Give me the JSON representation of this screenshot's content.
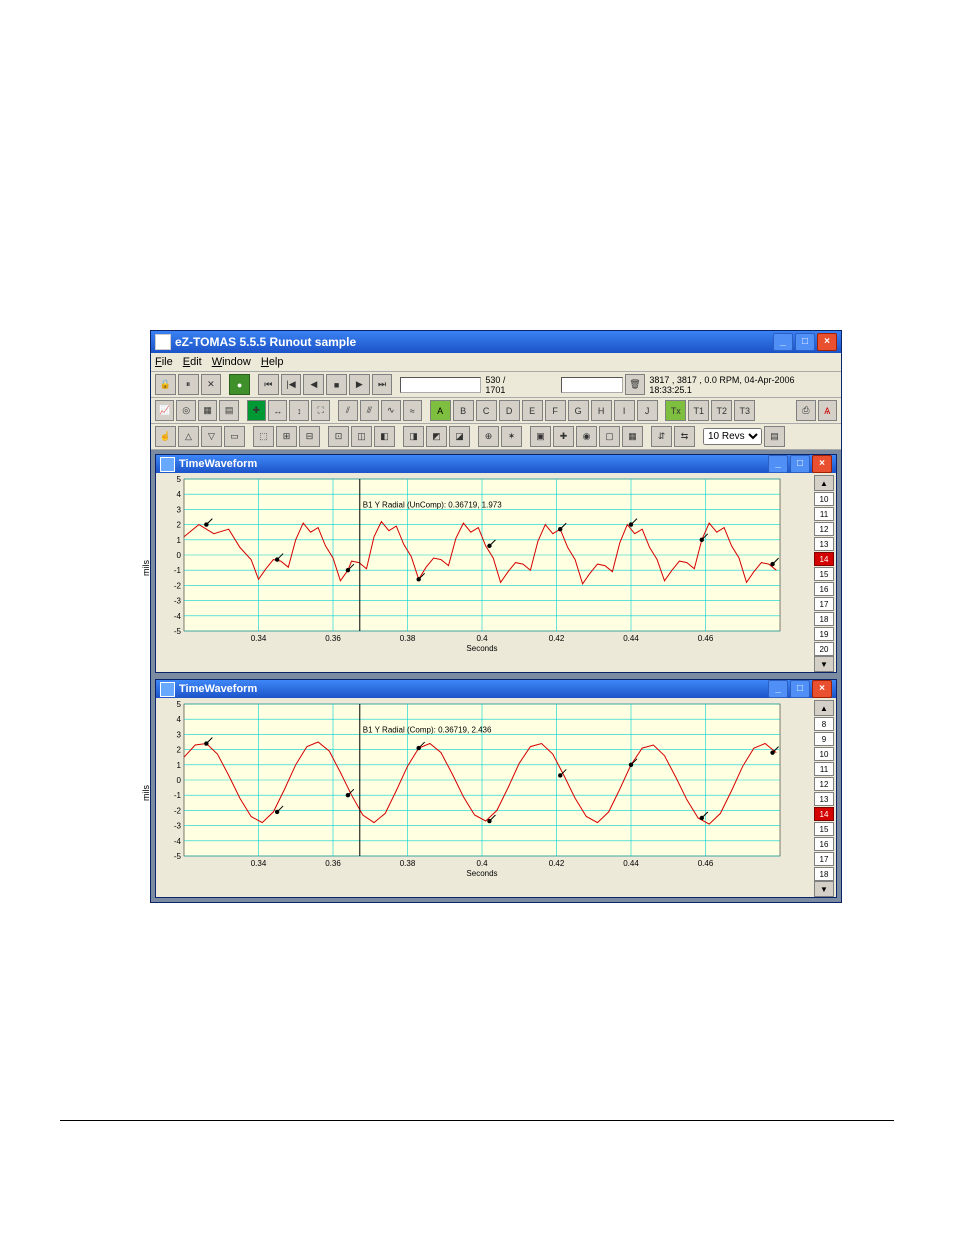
{
  "window": {
    "title": "eZ-TOMAS 5.5.5    Runout sample"
  },
  "menus": {
    "file": "File",
    "edit": "Edit",
    "window": "Window",
    "help": "Help"
  },
  "playback": {
    "position": "530 / 1701"
  },
  "status": {
    "text": "3817 , 3817 , 0.0 RPM,  04-Apr-2006 18:33:25.1"
  },
  "toolbar2_letters": [
    "A",
    "B",
    "C",
    "D",
    "E",
    "F",
    "G",
    "H",
    "I",
    "J"
  ],
  "tach_btns": [
    "Tx",
    "T1",
    "T2",
    "T3"
  ],
  "revs": {
    "value": "10 Revs"
  },
  "panes": [
    {
      "title": "TimeWaveform",
      "anno": "B1 Y Radial (UnComp): 0.36719, 1.973",
      "channels": [
        "10",
        "11",
        "12",
        "13",
        "14",
        "15",
        "16",
        "17",
        "18",
        "19",
        "20"
      ],
      "selected": "14",
      "x_ticks": [
        "0.34",
        "0.36",
        "0.38",
        "0.4",
        "0.42",
        "0.44",
        "0.46"
      ],
      "y_ticks": [
        "5",
        "4",
        "3",
        "2",
        "1",
        "0",
        "-1",
        "-2",
        "-3",
        "-4",
        "-5"
      ]
    },
    {
      "title": "TimeWaveform",
      "anno": "B1 Y Radial (Comp): 0.36719, 2.436",
      "channels": [
        "8",
        "9",
        "10",
        "11",
        "12",
        "13",
        "14",
        "15",
        "16",
        "17",
        "18"
      ],
      "selected": "14",
      "x_ticks": [
        "0.34",
        "0.36",
        "0.38",
        "0.4",
        "0.42",
        "0.44",
        "0.46"
      ],
      "y_ticks": [
        "5",
        "4",
        "3",
        "2",
        "1",
        "0",
        "-1",
        "-2",
        "-3",
        "-4",
        "-5"
      ]
    }
  ],
  "chart_data": [
    {
      "type": "line",
      "title": "TimeWaveform (Uncompensated)",
      "xlabel": "Seconds",
      "ylabel": "mils",
      "xlim": [
        0.32,
        0.48
      ],
      "ylim": [
        -5,
        5
      ],
      "cursor_x": 0.36719,
      "annotation": "B1 Y Radial (UnComp): 0.36719, 1.973",
      "series": [
        {
          "name": "B1 Y Radial UnComp",
          "x": [
            0.32,
            0.324,
            0.328,
            0.332,
            0.335,
            0.338,
            0.34,
            0.342,
            0.344,
            0.346,
            0.348,
            0.35,
            0.352,
            0.354,
            0.356,
            0.358,
            0.36,
            0.362,
            0.364,
            0.365,
            0.367,
            0.369,
            0.371,
            0.373,
            0.375,
            0.377,
            0.379,
            0.381,
            0.383,
            0.385,
            0.387,
            0.389,
            0.391,
            0.393,
            0.395,
            0.397,
            0.399,
            0.401,
            0.403,
            0.405,
            0.407,
            0.409,
            0.411,
            0.413,
            0.415,
            0.417,
            0.419,
            0.421,
            0.423,
            0.425,
            0.427,
            0.429,
            0.431,
            0.433,
            0.435,
            0.437,
            0.439,
            0.441,
            0.443,
            0.445,
            0.447,
            0.449,
            0.451,
            0.453,
            0.455,
            0.457,
            0.459,
            0.461,
            0.463,
            0.465,
            0.467,
            0.469,
            0.471,
            0.473,
            0.475,
            0.477,
            0.479
          ],
          "y": [
            1.2,
            2.0,
            1.4,
            1.7,
            0.5,
            -0.3,
            -1.6,
            -0.9,
            -0.3,
            -0.4,
            -0.8,
            1.0,
            2.1,
            1.5,
            1.8,
            0.6,
            -0.2,
            -1.7,
            -1.0,
            -0.4,
            -0.5,
            -0.9,
            1.2,
            2.2,
            1.6,
            1.9,
            0.7,
            -0.1,
            -1.6,
            -0.8,
            -0.2,
            -0.3,
            -0.7,
            1.1,
            2.1,
            1.5,
            1.8,
            0.6,
            -0.2,
            -1.8,
            -1.1,
            -0.5,
            -0.6,
            -1.0,
            0.9,
            2.0,
            1.4,
            1.7,
            0.5,
            -0.3,
            -1.9,
            -1.2,
            -0.6,
            -0.7,
            -1.1,
            0.8,
            2.0,
            1.4,
            1.7,
            0.5,
            -0.3,
            -1.7,
            -1.0,
            -0.4,
            -0.5,
            -0.9,
            1.0,
            2.1,
            1.5,
            1.8,
            0.6,
            -0.2,
            -1.8,
            -1.1,
            -0.5,
            -0.6,
            -1.0
          ]
        }
      ],
      "tach_marks_x": [
        0.326,
        0.345,
        0.364,
        0.383,
        0.402,
        0.421,
        0.44,
        0.459,
        0.478
      ]
    },
    {
      "type": "line",
      "title": "TimeWaveform (Compensated)",
      "xlabel": "Seconds",
      "ylabel": "mils",
      "xlim": [
        0.32,
        0.48
      ],
      "ylim": [
        -5,
        5
      ],
      "cursor_x": 0.36719,
      "annotation": "B1 Y Radial (Comp): 0.36719, 2.436",
      "series": [
        {
          "name": "B1 Y Radial Comp",
          "x": [
            0.32,
            0.323,
            0.326,
            0.329,
            0.332,
            0.335,
            0.338,
            0.341,
            0.344,
            0.347,
            0.35,
            0.353,
            0.356,
            0.359,
            0.362,
            0.365,
            0.368,
            0.371,
            0.374,
            0.377,
            0.38,
            0.383,
            0.386,
            0.389,
            0.392,
            0.395,
            0.398,
            0.401,
            0.404,
            0.407,
            0.41,
            0.413,
            0.416,
            0.419,
            0.422,
            0.425,
            0.428,
            0.431,
            0.434,
            0.437,
            0.44,
            0.443,
            0.446,
            0.449,
            0.452,
            0.455,
            0.458,
            0.461,
            0.464,
            0.467,
            0.47,
            0.473,
            0.476,
            0.479
          ],
          "y": [
            1.5,
            2.3,
            2.4,
            1.7,
            0.3,
            -1.2,
            -2.4,
            -2.8,
            -2.1,
            -0.6,
            1.0,
            2.2,
            2.5,
            1.9,
            0.5,
            -1.0,
            -2.3,
            -2.8,
            -2.2,
            -0.7,
            0.9,
            2.1,
            2.4,
            1.8,
            0.4,
            -1.1,
            -2.3,
            -2.7,
            -2.0,
            -0.5,
            1.1,
            2.2,
            2.4,
            1.7,
            0.3,
            -1.2,
            -2.4,
            -2.8,
            -2.1,
            -0.6,
            1.0,
            2.1,
            2.3,
            1.6,
            0.2,
            -1.3,
            -2.5,
            -2.9,
            -2.2,
            -0.7,
            0.9,
            2.1,
            2.4,
            1.8
          ]
        }
      ],
      "tach_marks_x": [
        0.326,
        0.345,
        0.364,
        0.383,
        0.402,
        0.421,
        0.44,
        0.459,
        0.478
      ]
    }
  ]
}
